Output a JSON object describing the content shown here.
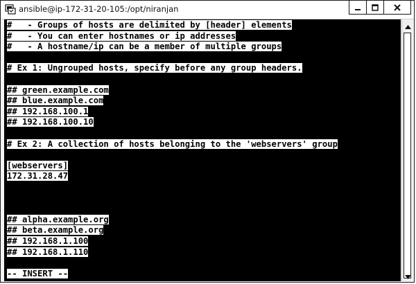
{
  "window": {
    "title": "ansible@ip-172-31-20-105:/opt/niranjan",
    "icon": "putty-terminal-icon",
    "controls": [
      "minimize-icon",
      "maximize-icon",
      "close-icon"
    ]
  },
  "terminal": {
    "lines": [
      "#   - Groups of hosts are delimited by [header] elements",
      "#   - You can enter hostnames or ip addresses",
      "#   - A hostname/ip can be a member of multiple groups",
      "",
      "# Ex 1: Ungrouped hosts, specify before any group headers.",
      "",
      "## green.example.com",
      "## blue.example.com",
      "## 192.168.100.1",
      "## 192.168.100.10",
      "",
      "# Ex 2: A collection of hosts belonging to the 'webservers' group",
      "",
      "[webservers]",
      "172.31.28.47",
      "",
      "",
      "",
      "## alpha.example.org",
      "## beta.example.org",
      "## 192.168.1.100",
      "## 192.168.1.110",
      "",
      "-- INSERT --"
    ]
  },
  "colors": {
    "terminal_bg": "#000000",
    "text_highlight": "#ffffff"
  }
}
